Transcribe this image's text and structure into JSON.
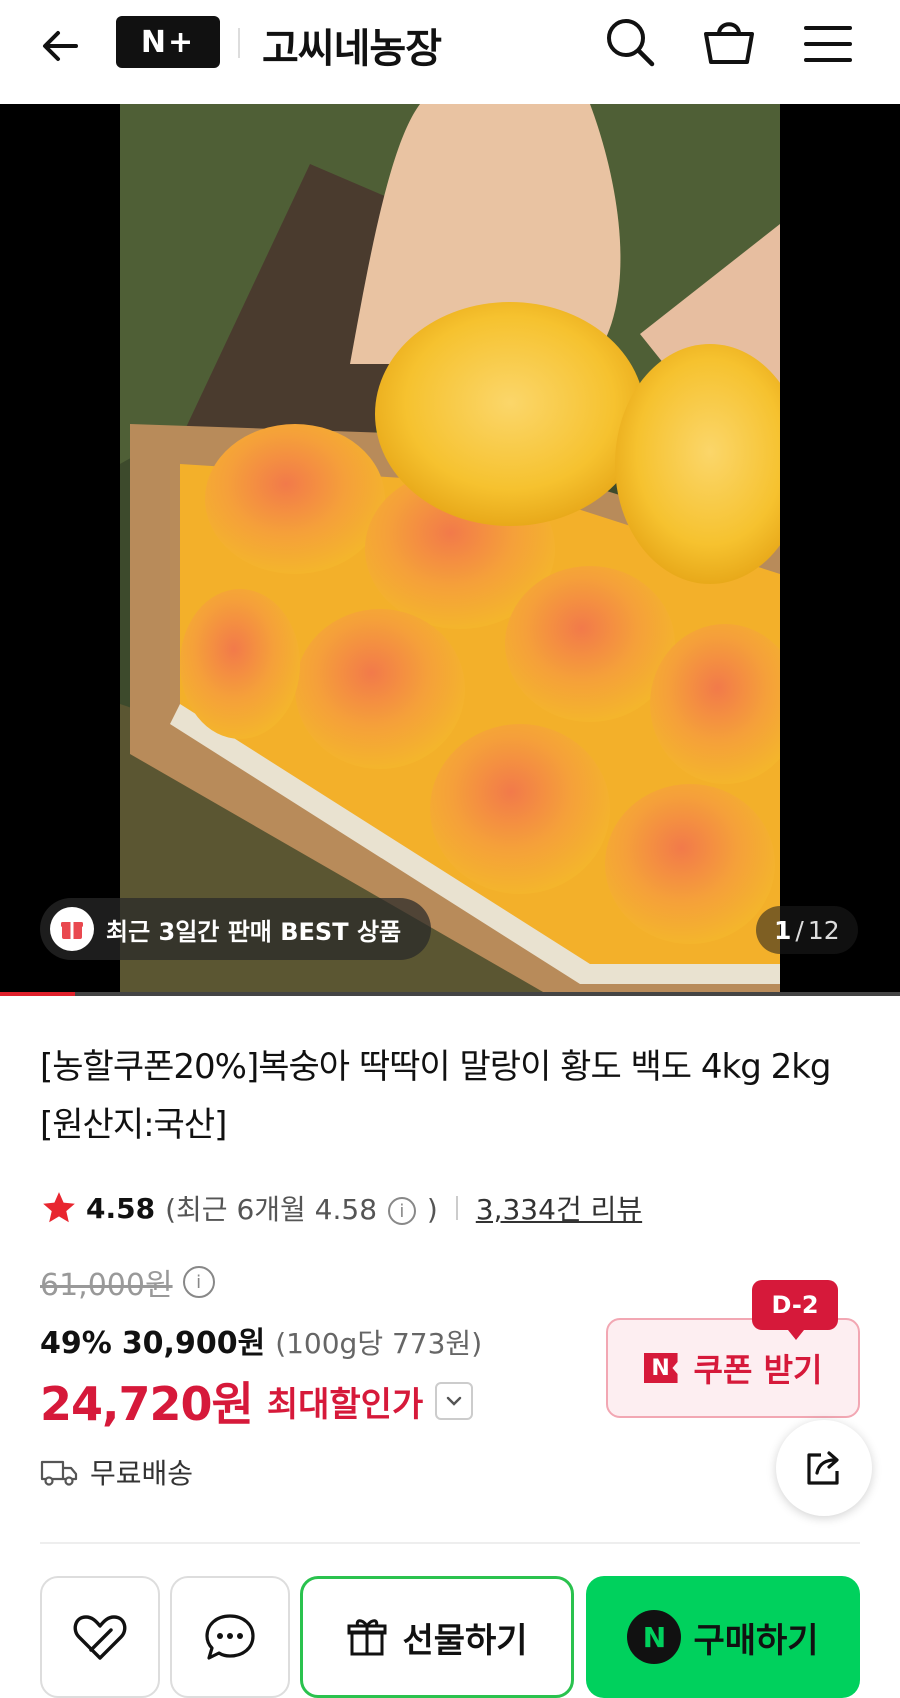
{
  "header": {
    "logo_text": "N+",
    "store_name": "고씨네농장",
    "icons": [
      "back-arrow-icon",
      "search-icon",
      "cart-icon",
      "menu-icon"
    ]
  },
  "media": {
    "badge_text": "최근 3일간 판매 BEST 상품",
    "current_page": "1",
    "page_separator": "/",
    "total_pages": "12",
    "progress": 0.083
  },
  "product": {
    "title": "[농할쿠폰20%]복숭아 딱딱이 말랑이 황도 백도 4kg 2kg [원산지:국산]"
  },
  "rating": {
    "score": "4.58",
    "recent_prefix": "(최근 6개월 4.58",
    "recent_suffix": ")",
    "reviews": "3,334건 리뷰"
  },
  "price": {
    "original": "61,000원",
    "discount_rate": "49%",
    "sale": "30,900원",
    "unit": "(100g당 773원)",
    "max_discount": "24,720원",
    "max_label": "최대할인가"
  },
  "coupon": {
    "dday": "D-2",
    "n_mark": "N",
    "label": "쿠폰 받기"
  },
  "shipping": {
    "label": "무료배송"
  },
  "bottom": {
    "gift_label": "선물하기",
    "buy_label": "구매하기",
    "buy_mark": "N"
  },
  "colors": {
    "accent_red": "#d6193a",
    "naver_green": "#00d15d",
    "progress_red": "#e0202b"
  }
}
